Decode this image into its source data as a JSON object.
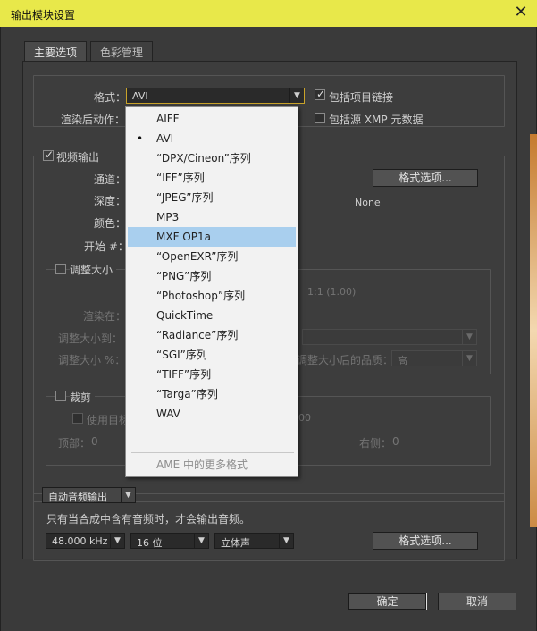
{
  "window": {
    "title": "输出模块设置"
  },
  "tabs": [
    {
      "label": "主要选项"
    },
    {
      "label": "色彩管理"
    }
  ],
  "format": {
    "label": "格式：",
    "value": "AVI",
    "include_project_link": "包括项目链接",
    "post_render_label": "渲染后动作：",
    "include_xmp": "包括源 XMP 元数据"
  },
  "video": {
    "header": "视频输出",
    "channel_label": "通道：",
    "depth_label": "深度：",
    "color_label": "颜色：",
    "start_label": "开始 #：",
    "format_options_button": "格式选项...",
    "codec_value": "None"
  },
  "resize": {
    "header": "调整大小",
    "ratio_text": "1:1 (1.00)",
    "render_at": "渲染在：",
    "resize_to": "调整大小到：",
    "resize_percent": "调整大小 %：",
    "quality_label": "调整大小后的品质：",
    "quality_value": "高"
  },
  "crop": {
    "header": "裁剪",
    "use_target": "使用目标",
    "value_00": "00",
    "top_label": "顶部：",
    "top_value": "0",
    "right_label": "右侧：",
    "right_value": "0"
  },
  "audio": {
    "mode": "自动音频输出",
    "note": "只有当合成中含有音频时，才会输出音频。",
    "sample_rate": "48.000 kHz",
    "bit_depth": "16 位",
    "channels": "立体声",
    "format_options_button": "格式选项..."
  },
  "footer": {
    "ok": "确定",
    "cancel": "取消"
  },
  "dropdown": {
    "items": [
      {
        "label": "AIFF"
      },
      {
        "label": "AVI"
      },
      {
        "label": "“DPX/Cineon”序列"
      },
      {
        "label": "“IFF”序列"
      },
      {
        "label": "“JPEG”序列"
      },
      {
        "label": "MP3"
      },
      {
        "label": "MXF OP1a"
      },
      {
        "label": "“OpenEXR”序列"
      },
      {
        "label": "“PNG”序列"
      },
      {
        "label": "“Photoshop”序列"
      },
      {
        "label": "QuickTime"
      },
      {
        "label": "“Radiance”序列"
      },
      {
        "label": "“SGI”序列"
      },
      {
        "label": "“TIFF”序列"
      },
      {
        "label": "“Targa”序列"
      },
      {
        "label": "WAV"
      }
    ],
    "more_formats": "AME 中的更多格式",
    "current_marker": "•"
  },
  "colors": {
    "titlebar": "#e8e84a",
    "highlight": "#a9cfee",
    "panel": "#3d3d3d"
  }
}
